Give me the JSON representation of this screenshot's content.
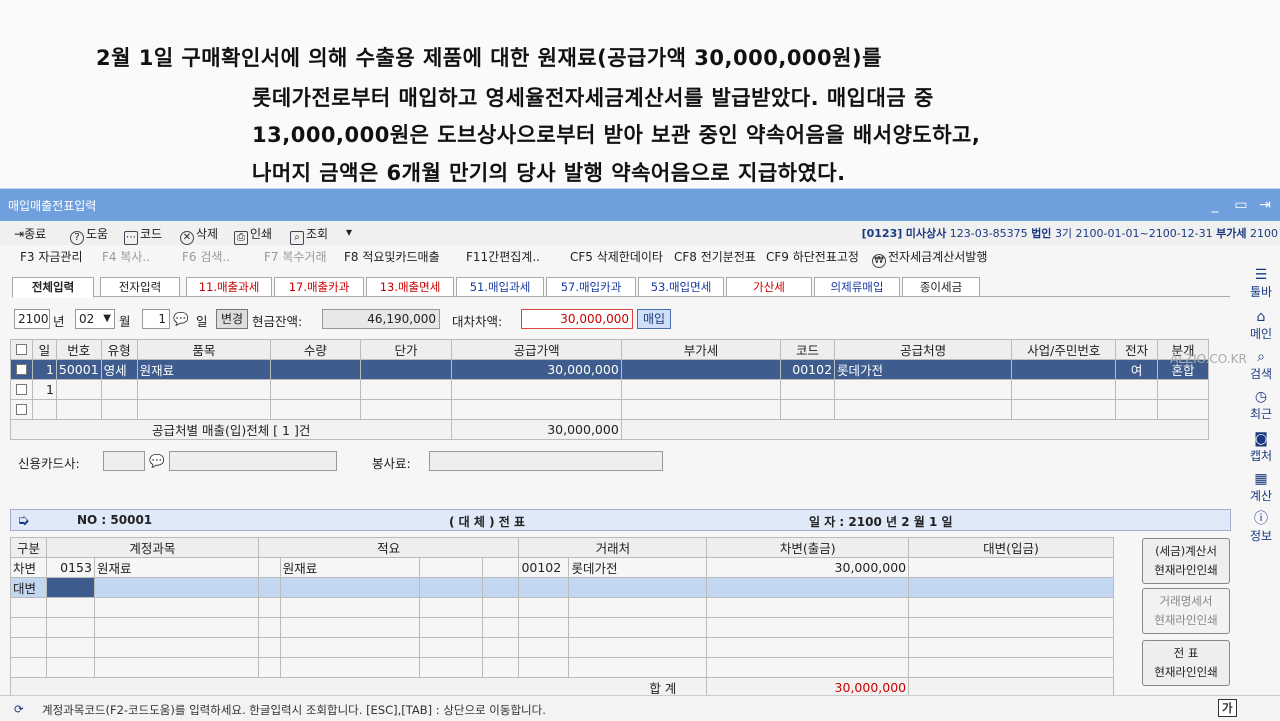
{
  "question": {
    "line1": "2월   1일   구매확인서에   의해   수출용   제품에   대한   원재료(공급가액   30,000,000원)를",
    "line2": "롯데가전로부터   매입하고   영세율전자세금계산서를   발급받았다.  매입대금   중",
    "line3": "13,000,000원은   도브상사으로부터   받아   보관   중인   약속어음을   배서양도하고,",
    "line4": "나머지  금액은  6개월  만기의  당사  발행  약속어음으로  지급하였다."
  },
  "window": {
    "title": "매입매출전표입력"
  },
  "toolbar": {
    "close": "종료",
    "help": "도움",
    "code": "코드",
    "delete": "삭제",
    "print": "인쇄",
    "search": "조회",
    "more": "▾"
  },
  "company": {
    "code": "[0123]",
    "name": "미사상사",
    "biz_no": "123-03-85375",
    "type": "법인",
    "period": "3기 2100-01-01~2100-12-31",
    "tax_label": "부가세",
    "year": "2100"
  },
  "fkeys": {
    "f3": "F3 자금관리",
    "f4": "F4 복사..",
    "f6": "F6 검색..",
    "f7": "F7 복수거래",
    "f8": "F8 적요및카드매출",
    "f11": "F11간편집계..",
    "cf5": "CF5 삭제한데이타",
    "cf8": "CF8 전기분전표",
    "cf9": "CF9 하단전표고정",
    "etax": "전자세금계산서발행"
  },
  "tabs": [
    "전체입력",
    "전자입력",
    "11.매출과세",
    "17.매출카과",
    "13.매출면세",
    "51.매입과세",
    "57.매입카과",
    "53.매입면세",
    "가산세",
    "의제류매입",
    "종이세금"
  ],
  "header": {
    "year": "2100",
    "year_lbl": "년",
    "month": "02",
    "month_lbl": "월",
    "day": "1",
    "day_lbl": "일",
    "change_btn": "변경",
    "cash_lbl": "현금잔액:",
    "cash": "46,190,000",
    "diff_lbl": "대차차액:",
    "diff": "30,000,000",
    "mode_btn": "매입"
  },
  "upper_table": {
    "headers": [
      "일",
      "번호",
      "유형",
      "품목",
      "수량",
      "단가",
      "공급가액",
      "부가세",
      "코드",
      "공급처명",
      "사업/주민번호",
      "전자",
      "분개"
    ],
    "rows": [
      {
        "day": "1",
        "no": "50001",
        "type": "영세",
        "item": "원재료",
        "qty": "",
        "price": "",
        "amount": "30,000,000",
        "vat": "",
        "code": "00102",
        "vendor": "롯데가전",
        "bizno": "",
        "etax": "여",
        "journal": "혼합"
      },
      {
        "day": "1",
        "no": "",
        "type": "",
        "item": "",
        "qty": "",
        "price": "",
        "amount": "",
        "vat": "",
        "code": "",
        "vendor": "",
        "bizno": "",
        "etax": "",
        "journal": ""
      }
    ],
    "summary_label": "공급처별 매출(입)전체 [ 1 ]건",
    "summary_amount": "30,000,000"
  },
  "card_lbl": "신용카드사:",
  "service_lbl": "봉사료:",
  "watermark": "ALZIO.CO.KR",
  "banner": {
    "no": "NO : 50001",
    "kind": "( 대 체 )  전 표",
    "date": "일 자 : 2100 년  2 월  1 일"
  },
  "lower_table": {
    "headers": [
      "구분",
      "계정과목",
      "적요",
      "거래처",
      "차변(출금)",
      "대변(입금)"
    ],
    "rows": [
      {
        "div": "차변",
        "acct_code": "0153",
        "acct": "원재료",
        "memo": "원재료",
        "vcode": "00102",
        "vendor": "롯데가전",
        "debit": "30,000,000",
        "credit": ""
      },
      {
        "div": "대변",
        "acct_code": "",
        "acct": "",
        "memo": "",
        "vcode": "",
        "vendor": "",
        "debit": "",
        "credit": ""
      }
    ],
    "total_label": "합   계",
    "total_debit": "30,000,000",
    "total_credit": ""
  },
  "right_buttons": {
    "b1_l1": "(세금)계산서",
    "b1_l2": "현재라인인쇄",
    "b2_l1": "거래명세서",
    "b2_l2": "현재라인인쇄",
    "b3_l1": "전  표",
    "b3_l2": "현재라인인쇄"
  },
  "sidebar": [
    "툴바",
    "메인",
    "검색",
    "최근",
    "캡처",
    "계산",
    "정보"
  ],
  "status": {
    "message": "계정과목코드(F2-코드도움)를 입력하세요. 한글입력시 조회합니다.  [ESC],[TAB] : 상단으로 이동합니다.",
    "ime": "가"
  }
}
